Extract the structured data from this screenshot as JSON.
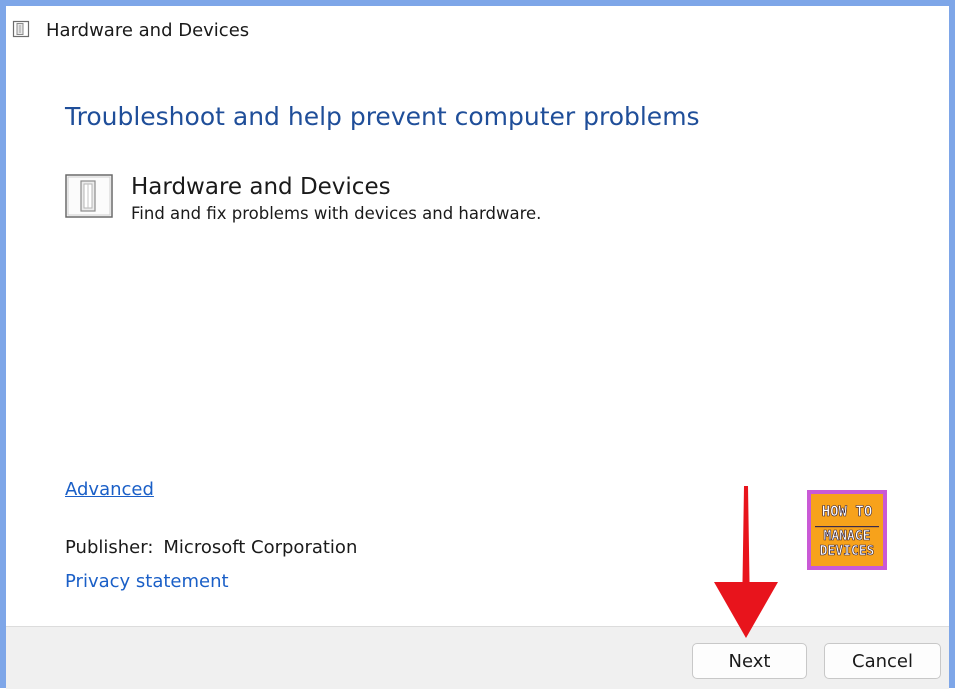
{
  "window": {
    "title": "Hardware and Devices"
  },
  "content": {
    "heading": "Troubleshoot and help prevent computer problems",
    "tool": {
      "name": "Hardware and Devices",
      "description": "Find and fix problems with devices and hardware."
    },
    "advanced_link": "Advanced",
    "publisher_label": "Publisher:",
    "publisher_value": "Microsoft Corporation",
    "privacy_link": "Privacy statement"
  },
  "logo": {
    "line1": "HOW TO",
    "line2": "MANAGE",
    "line3": "DEVICES"
  },
  "footer": {
    "next_label": "Next",
    "cancel_label": "Cancel"
  },
  "colors": {
    "accent_heading": "#1f4e99",
    "link": "#1a5fc7",
    "frame_border": "#7ea6e8",
    "annotation_arrow": "#e8141c",
    "logo_bg": "#f7a21b",
    "logo_border": "#c95ad6"
  },
  "icons": {
    "title_icon": "hardware-devices-icon",
    "tool_icon": "hardware-devices-icon",
    "annotation": "red-down-arrow"
  }
}
